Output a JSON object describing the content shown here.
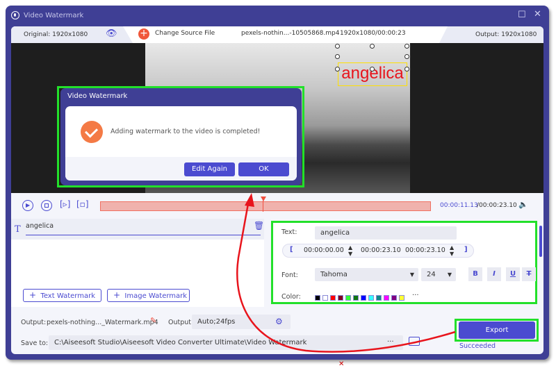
{
  "window": {
    "title": "Video Watermark"
  },
  "header": {
    "original": "Original: 1920x1080",
    "change_source": "Change Source File",
    "file_name": "pexels-nothin...-10505868.mp4",
    "file_info": "1920x1080/00:00:23",
    "output": "Output: 1920x1080"
  },
  "preview": {
    "watermark_text": "angelica"
  },
  "dialog": {
    "title": "Video Watermark",
    "message": "Adding watermark to the video is completed!",
    "edit_again": "Edit Again",
    "ok": "OK"
  },
  "timeline": {
    "current": "00:00:11.13",
    "total": "/00:00:23.10",
    "progress": 0.48
  },
  "layers": {
    "items": [
      {
        "label": "angelica"
      }
    ],
    "text_watermark": "Text Watermark",
    "image_watermark": "Image Watermark"
  },
  "props": {
    "text_label": "Text:",
    "text_value": "angelica",
    "start": "00:00:00.00",
    "end": "00:00:23.10",
    "duration": "00:00:23.10",
    "font_label": "Font:",
    "font": "Tahoma",
    "size": "24",
    "bold": "B",
    "italic": "I",
    "underline": "U",
    "strike": "T",
    "color_label": "Color:",
    "colors": [
      "#000000",
      "#ffffff",
      "#ff0000",
      "#800020",
      "#33ff33",
      "#117711",
      "#0000ff",
      "#33ffff",
      "#118888",
      "#ff00ff",
      "#800080",
      "#ffff33"
    ],
    "more": "···"
  },
  "bottom": {
    "output_label": "Output:",
    "output_file": "pexels-nothing..._Watermark.mp4",
    "output_label2": "Output:",
    "output_format": "Auto;24fps",
    "save_label": "Save to:",
    "save_path": "C:\\Aiseesoft Studio\\Aiseesoft Video Converter Ultimate\\Video Watermark",
    "browse": "···",
    "export": "Export",
    "status": "Succeeded"
  },
  "colors": {
    "accent": "#4b4bd0",
    "frame": "#3f3f95",
    "highlight": "#22e02a",
    "annotation": "#e8141c"
  }
}
